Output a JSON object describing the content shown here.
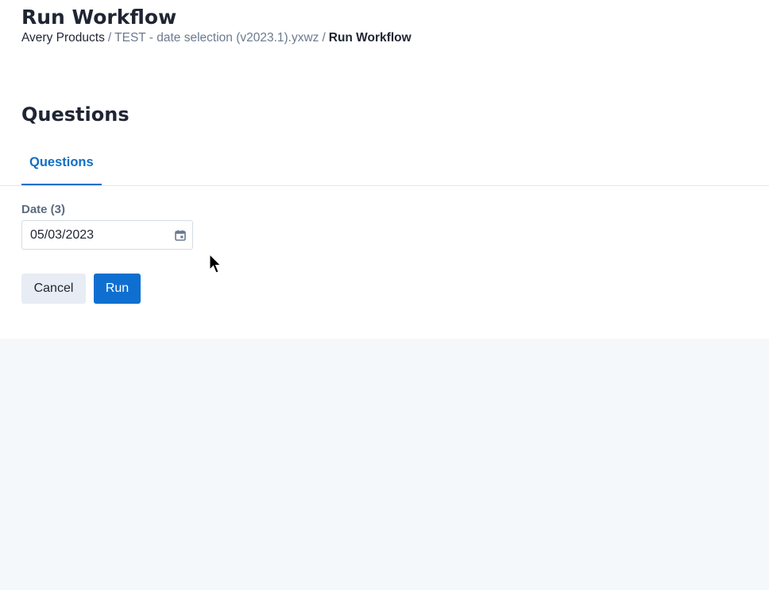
{
  "header": {
    "title": "Run Workflow",
    "breadcrumb": {
      "items": [
        "Avery Products",
        "TEST - date selection (v2023.1).yxwz"
      ],
      "separator": "/",
      "current": "Run Workflow"
    }
  },
  "main": {
    "section_title": "Questions",
    "tabs": [
      {
        "label": "Questions",
        "active": true
      }
    ],
    "form": {
      "date_field": {
        "label": "Date (3)",
        "value": "05/03/2023",
        "icon": "calendar-icon"
      }
    },
    "actions": {
      "cancel_label": "Cancel",
      "run_label": "Run"
    }
  },
  "colors": {
    "accent": "#0f6fd0",
    "text": "#1f2533",
    "muted": "#6b7a8f",
    "page_background": "#f5f8fb",
    "panel_background": "#ffffff"
  }
}
